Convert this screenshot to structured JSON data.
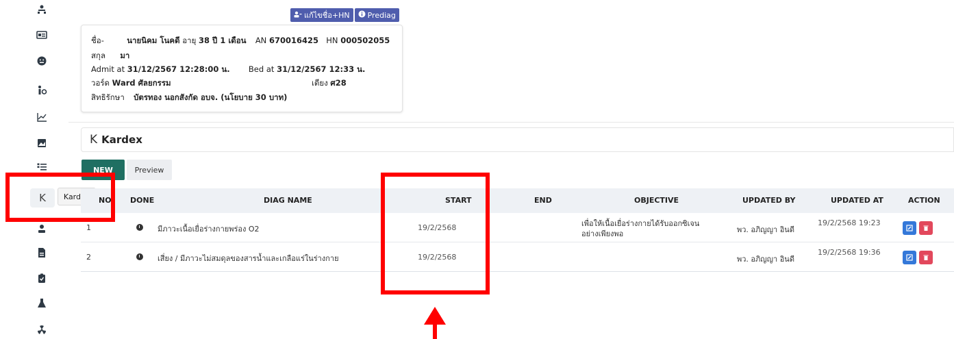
{
  "sidebar": {
    "kardex_letter": "K",
    "tooltip": "Kardex"
  },
  "top_buttons": {
    "edit_name": "แก้ไขชื่อ+HN",
    "prediag": "Prediag"
  },
  "patient": {
    "name_label": "ชื่อ-",
    "surname_label": "สกุล",
    "name": "นายนิคม โนคดี",
    "surname": "มา",
    "age_label": "อายุ",
    "age": "38 ปี 1 เดือน",
    "an_label": "AN",
    "an": "670016425",
    "hn_label": "HN",
    "hn": "000502055",
    "admit_label": "Admit at",
    "admit": "31/12/2567 12:28:00 น.",
    "bed_at_label": "Bed at",
    "bed_at": "31/12/2567 12:33 น.",
    "ward_label": "วอร์ด",
    "ward": "Ward ศัลยกรรม",
    "bed_label": "เตียง",
    "bed": "ศ28",
    "right_label": "สิทธิรักษา",
    "right": "บัตรทอง นอกสังกัด อบจ. (นโยบาย 30 บาท)"
  },
  "kardex": {
    "icon_letter": "K",
    "title": "Kardex",
    "new_button": "NEW",
    "preview_button": "Preview"
  },
  "table": {
    "headers": {
      "no": "NO",
      "done": "DONE",
      "diag_name": "DIAG NAME",
      "start": "START",
      "end": "END",
      "objective": "OBJECTIVE",
      "updated_by": "UPDATED BY",
      "updated_at": "UPDATED AT",
      "action": "ACTION"
    },
    "rows": [
      {
        "no": "1",
        "diag_name": "มีภาวะเนื้อเยื่อร่างกายพร่อง O2",
        "start": "19/2/2568",
        "end": "",
        "objective_1": "เพื่อให้เนื้อเยื่อร่างกายได้รับออกซิเจน",
        "objective_2": "อย่างเพียงพอ",
        "updated_by": "พว. อภิญญา อินดี",
        "updated_at": "19/2/2568 19:23"
      },
      {
        "no": "2",
        "diag_name": "เสี่ยง / มีภาวะไม่สมดุลของสารน้ำและเกลือแร่ในร่างกาย",
        "start": "19/2/2568",
        "end": "",
        "objective_1": "",
        "objective_2": "",
        "updated_by": "พว. อภิญญา อินดี",
        "updated_at": "19/2/2568 19:36"
      }
    ]
  },
  "colors": {
    "primary_button": "#1f6f62",
    "edit_button": "#3478d9",
    "delete_button": "#e2485c",
    "annotation_red": "#ff0000",
    "top_button": "#4f5dad"
  }
}
